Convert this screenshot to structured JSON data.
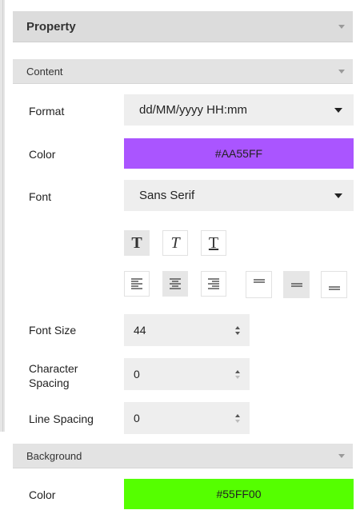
{
  "panel": {
    "title": "Property"
  },
  "content_section": {
    "title": "Content",
    "format": {
      "label": "Format",
      "value": "dd/MM/yyyy HH:mm"
    },
    "color": {
      "label": "Color",
      "value": "#AA55FF",
      "hex": "#AA55FF"
    },
    "font": {
      "label": "Font",
      "value": "Sans Serif"
    },
    "style_buttons": [
      {
        "name": "bold",
        "glyph": "T",
        "active": true
      },
      {
        "name": "italic",
        "glyph": "T",
        "active": false
      },
      {
        "name": "underline",
        "glyph": "T",
        "active": false
      }
    ],
    "horizontal_align": [
      {
        "name": "align-left-icon",
        "active": false
      },
      {
        "name": "align-center-icon",
        "active": true
      },
      {
        "name": "align-right-icon",
        "active": false
      }
    ],
    "vertical_align": [
      {
        "name": "valign-top-icon",
        "active": false
      },
      {
        "name": "valign-middle-icon",
        "active": true
      },
      {
        "name": "valign-bottom-icon",
        "active": false
      }
    ],
    "font_size": {
      "label": "Font Size",
      "value": "44"
    },
    "character_spacing": {
      "label_line1": "Character",
      "label_line2": "Spacing",
      "value": "0"
    },
    "line_spacing": {
      "label": "Line Spacing",
      "value": "0"
    }
  },
  "background_section": {
    "title": "Background",
    "color": {
      "label": "Color",
      "value": "#55FF00",
      "hex": "#55FF00"
    }
  }
}
